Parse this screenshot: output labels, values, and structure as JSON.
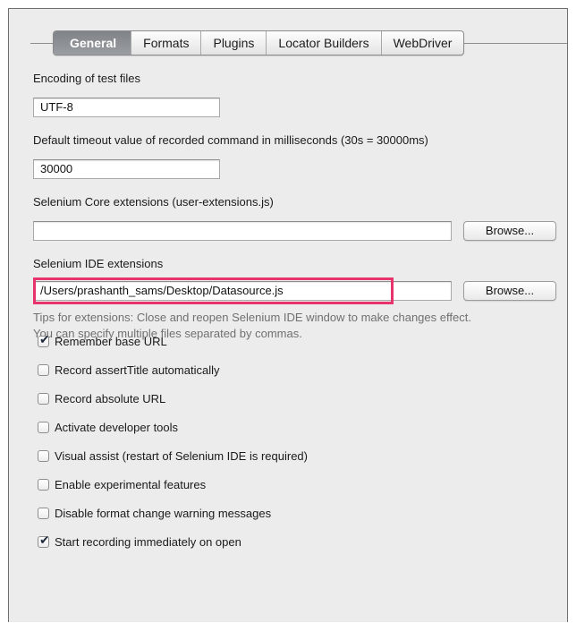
{
  "tabs": [
    {
      "label": "General",
      "active": true
    },
    {
      "label": "Formats",
      "active": false
    },
    {
      "label": "Plugins",
      "active": false
    },
    {
      "label": "Locator Builders",
      "active": false
    },
    {
      "label": "WebDriver",
      "active": false
    }
  ],
  "encoding": {
    "label": "Encoding of test files",
    "value": "UTF-8"
  },
  "timeout": {
    "label": "Default timeout value of recorded command in milliseconds (30s = 30000ms)",
    "value": "30000"
  },
  "core_ext": {
    "label": "Selenium Core extensions (user-extensions.js)",
    "value": "",
    "browse_label": "Browse..."
  },
  "ide_ext": {
    "label": "Selenium IDE extensions",
    "value": "/Users/prashanth_sams/Desktop/Datasource.js",
    "browse_label": "Browse..."
  },
  "tips": {
    "line1": "Tips for extensions: Close and reopen Selenium IDE window to make changes effect.",
    "line2": "You can specify multiple files separated by commas."
  },
  "options": [
    {
      "label": "Remember base URL",
      "checked": true
    },
    {
      "label": "Record assertTitle automatically",
      "checked": false
    },
    {
      "label": "Record absolute URL",
      "checked": false
    },
    {
      "label": "Activate developer tools",
      "checked": false
    },
    {
      "label": "Visual assist (restart of Selenium IDE is required)",
      "checked": false
    },
    {
      "label": "Enable experimental features",
      "checked": false
    },
    {
      "label": "Disable format change warning messages",
      "checked": false
    },
    {
      "label": "Start recording immediately on open",
      "checked": true
    }
  ],
  "colors": {
    "highlight": "#e8336c",
    "panel": "#ececec",
    "active_tab": "#8a8e92"
  },
  "icons": {
    "check": "checkmark-icon"
  }
}
